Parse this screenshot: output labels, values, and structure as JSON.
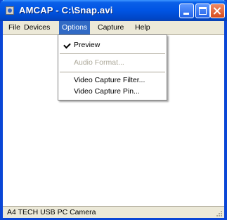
{
  "window": {
    "title": "AMCAP - C:\\Snap.avi"
  },
  "menubar": {
    "items": [
      "File",
      "Devices",
      "Options",
      "Capture",
      "Help"
    ],
    "active": "Options"
  },
  "options_menu": {
    "items": [
      {
        "label": "Preview",
        "checked": true,
        "enabled": true
      },
      {
        "label": "Audio Format...",
        "checked": false,
        "enabled": false
      },
      {
        "label": "Video Capture Filter...",
        "checked": false,
        "enabled": true
      },
      {
        "label": "Video Capture Pin...",
        "checked": false,
        "enabled": true
      }
    ]
  },
  "statusbar": {
    "text": "A4 TECH USB PC Camera"
  },
  "colors": {
    "titlebar": "#0054e3",
    "menu_highlight": "#316ac5",
    "disabled_text": "#aca899"
  }
}
